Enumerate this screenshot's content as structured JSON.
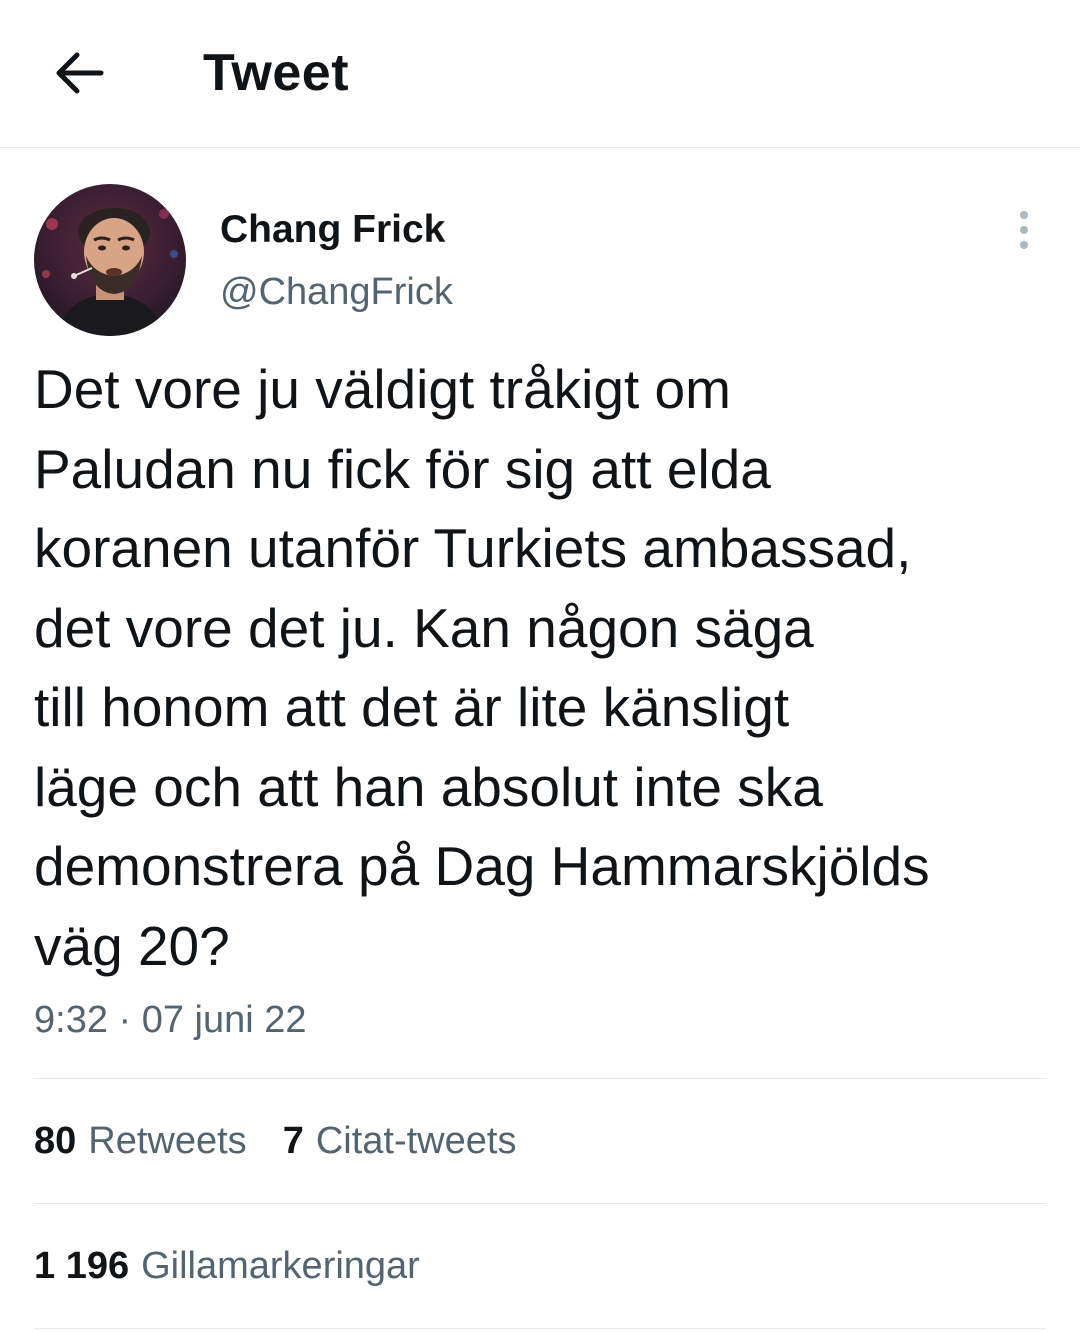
{
  "header": {
    "title": "Tweet",
    "back_icon": "arrow-left-icon"
  },
  "author": {
    "name": "Chang Frick",
    "handle": "@ChangFrick"
  },
  "more_icon": "more-vertical-icon",
  "tweet": {
    "lines": [
      "Det vore ju väldigt tråkigt om",
      "Paludan nu fick för sig att elda",
      "koranen utanför Turkiets ambassad,",
      "det vore det ju. Kan någon säga",
      "till honom att det är lite känsligt",
      "läge och att han absolut inte ska",
      "demonstrera på Dag Hammarskjölds",
      "väg 20?"
    ],
    "timestamp": "9:32 · 07 juni 22"
  },
  "stats": {
    "retweets_count": "80",
    "retweets_label": "Retweets",
    "quotes_count": "7",
    "quotes_label": "Citat-tweets",
    "likes_count": "1 196",
    "likes_label": "Gillamarkeringar"
  },
  "colors": {
    "text": "#0f1419",
    "secondary": "#536471",
    "divider": "#e1e8ed"
  }
}
